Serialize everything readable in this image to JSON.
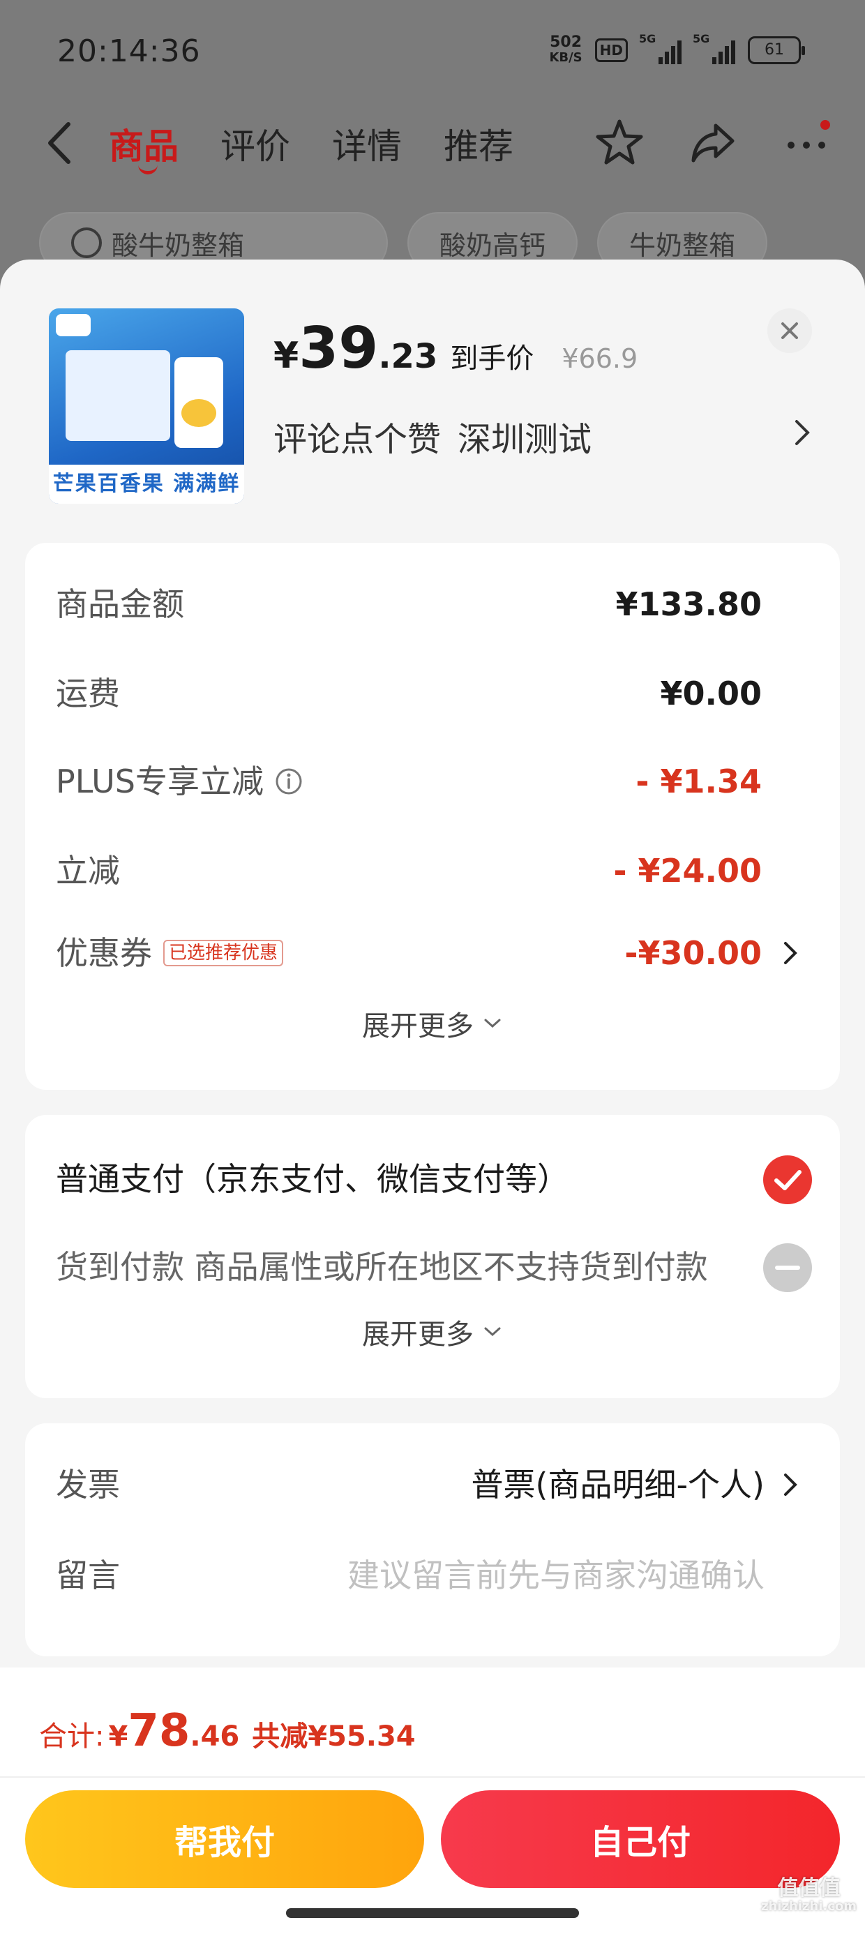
{
  "status_bar": {
    "time": "20:14:36",
    "net_speed_value": "502",
    "net_speed_unit": "KB/S",
    "hd_badge": "HD",
    "signal1_label": "5G",
    "signal2_label": "5G",
    "battery": "61"
  },
  "nav": {
    "tabs": [
      {
        "label": "商品",
        "active": true
      },
      {
        "label": "评价",
        "active": false
      },
      {
        "label": "详情",
        "active": false
      },
      {
        "label": "推荐",
        "active": false
      }
    ]
  },
  "search_chips": [
    "酸牛奶整箱",
    "酸奶高钙",
    "牛奶整箱"
  ],
  "product": {
    "thumb_strip_text": "芒果百香果 满满鲜果",
    "price_yen": "¥",
    "price_int": "39",
    "price_dec": ".23",
    "price_label": "到手价",
    "original_price": "¥66.9",
    "comment_text": "评论点个赞",
    "location_text": "深圳测试"
  },
  "price_breakdown": {
    "rows": [
      {
        "label": "商品金额",
        "value": "¥133.80",
        "red": false
      },
      {
        "label": "运费",
        "value": "¥0.00",
        "red": false
      },
      {
        "label": "PLUS专享立减",
        "value": "- ¥1.34",
        "red": true
      },
      {
        "label": "立减",
        "value": "- ¥24.00",
        "red": true
      },
      {
        "label": "优惠券",
        "value": "-¥30.00",
        "red": true
      }
    ],
    "coupon_badge": "已选推荐优惠",
    "expand_label": "展开更多"
  },
  "payment": {
    "options": [
      {
        "label": "普通支付（京东支付、微信支付等）",
        "selected": true
      },
      {
        "label": "货到付款 商品属性或所在地区不支持货到付款",
        "selected": false
      }
    ],
    "expand_label": "展开更多"
  },
  "invoice": {
    "invoice_label": "发票",
    "invoice_value": "普票(商品明细-个人)",
    "note_label": "留言",
    "note_placeholder": "建议留言前先与商家沟通确认"
  },
  "footer": {
    "total_label": "合计:",
    "total_yen": "¥",
    "total_int": "78",
    "total_dec": ".46",
    "savings": "共减¥55.34",
    "help_pay_label": "帮我付",
    "self_pay_label": "自己付"
  },
  "watermark": {
    "text": "值值值",
    "sub": "zhizhizhi.com"
  },
  "colors": {
    "accent_red": "#d8341e",
    "brand_red": "#c81a1a",
    "help_button": "#ffb515",
    "self_button": "#f4303a"
  }
}
